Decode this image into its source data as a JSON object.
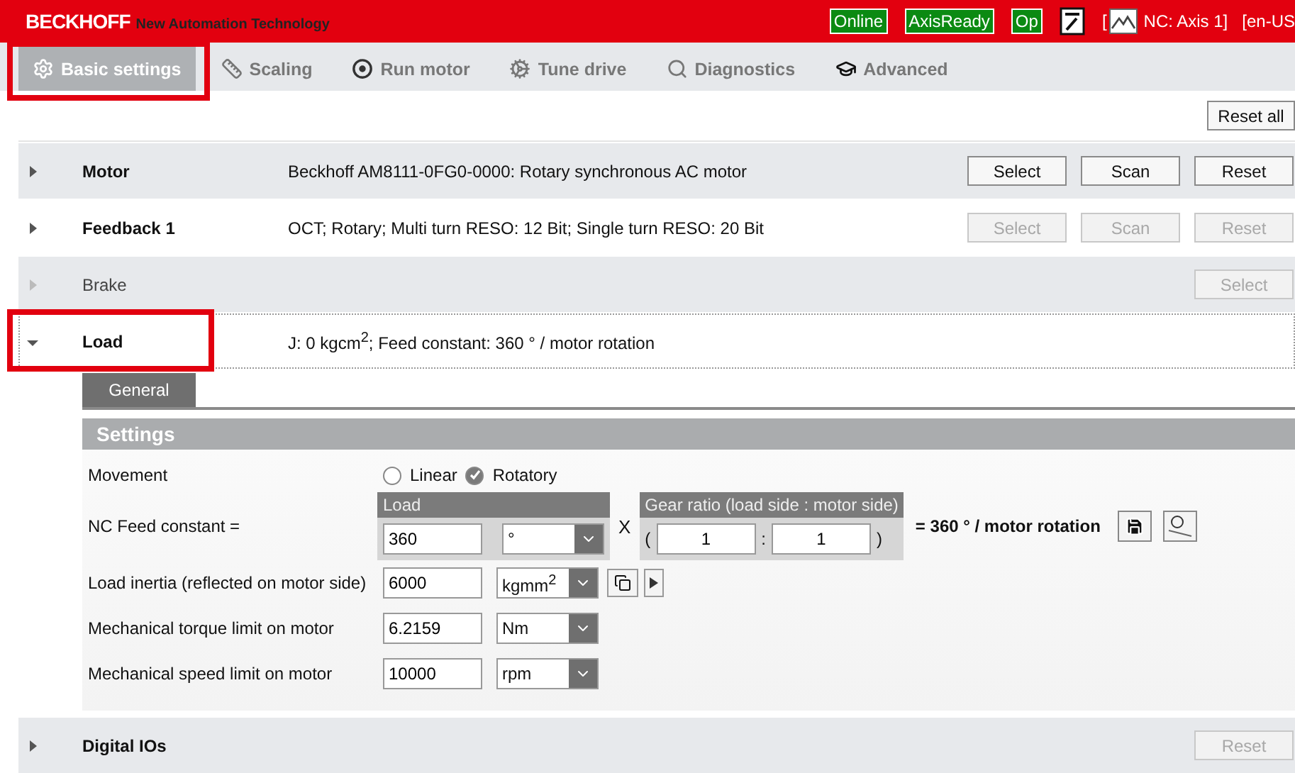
{
  "header": {
    "brand": "BECKHOFF",
    "tagline": "New Automation Technology",
    "statuses": [
      "Online",
      "AxisReady",
      "Op"
    ],
    "axis_open": "[",
    "axis": "NC: Axis 1]",
    "language": "[en-US"
  },
  "tabs": [
    {
      "label": "Basic settings",
      "kind": "gear",
      "selected": true
    },
    {
      "label": "Scaling",
      "kind": "scale",
      "selected": false
    },
    {
      "label": "Run motor",
      "kind": "motor",
      "selected": false
    },
    {
      "label": "Tune drive",
      "kind": "cogs",
      "selected": false
    },
    {
      "label": "Diagnostics",
      "kind": "diagnose",
      "selected": false
    },
    {
      "label": "Advanced",
      "kind": "cap",
      "selected": false
    }
  ],
  "reset_all": "Reset all",
  "sections": [
    {
      "title": "Motor",
      "description": "Beckhoff AM8111-0FG0-0000: Rotary synchronous AC motor",
      "expanded": false,
      "disabled": false,
      "buttons": [
        {
          "label": "Select",
          "disabled": false
        },
        {
          "label": "Scan",
          "disabled": false
        },
        {
          "label": "Reset",
          "disabled": false
        }
      ]
    },
    {
      "title": "Feedback 1",
      "description": "OCT; Rotary; Multi turn RESO: 12 Bit; Single turn RESO: 20 Bit",
      "expanded": false,
      "disabled": false,
      "buttons": [
        {
          "label": "Select",
          "disabled": true
        },
        {
          "label": "Scan",
          "disabled": true
        },
        {
          "label": "Reset",
          "disabled": true
        }
      ]
    },
    {
      "title": "Brake",
      "expanded": false,
      "disabled": true,
      "buttons": [
        {
          "label": "Select",
          "disabled": true
        }
      ]
    },
    {
      "title": "Load",
      "description": "J: 0 kgcm$^{2}$; Feed constant: 360 ° / motor rotation",
      "expanded": true,
      "disabled": false
    }
  ],
  "load_panel": {
    "subtabs": [
      {
        "label": "General",
        "selected": true
      }
    ],
    "settings_title": "Settings",
    "movement": {
      "label": "Movement",
      "options": [
        {
          "label": "Linear",
          "selected": false
        },
        {
          "label": "Rotatory",
          "selected": true
        }
      ]
    },
    "feed": {
      "label": "NC Feed constant =",
      "load_header": "Load",
      "value": "360",
      "unit": "°",
      "times": "X",
      "open": "(",
      "gear_header": "Gear ratio (load side : motor side)",
      "gear_load": "1",
      "colon": ":",
      "gear_motor": "1",
      "close": ")",
      "result": "= 360 ° / motor rotation"
    },
    "rows": [
      {
        "label": "Load inertia (reflected on motor side)",
        "value": "6000",
        "unit": "kgmm$^{2}$",
        "extras": true
      },
      {
        "label": "Mechanical torque limit on motor",
        "value": "6.2159",
        "unit": "Nm",
        "extras": false
      },
      {
        "label": "Mechanical speed limit on motor",
        "value": "10000",
        "unit": "rpm",
        "extras": false
      }
    ]
  },
  "footer_section": {
    "title": "Digital IOs",
    "expanded": false,
    "disabled": false,
    "buttons": [
      {
        "label": "Reset",
        "disabled": true
      }
    ]
  }
}
